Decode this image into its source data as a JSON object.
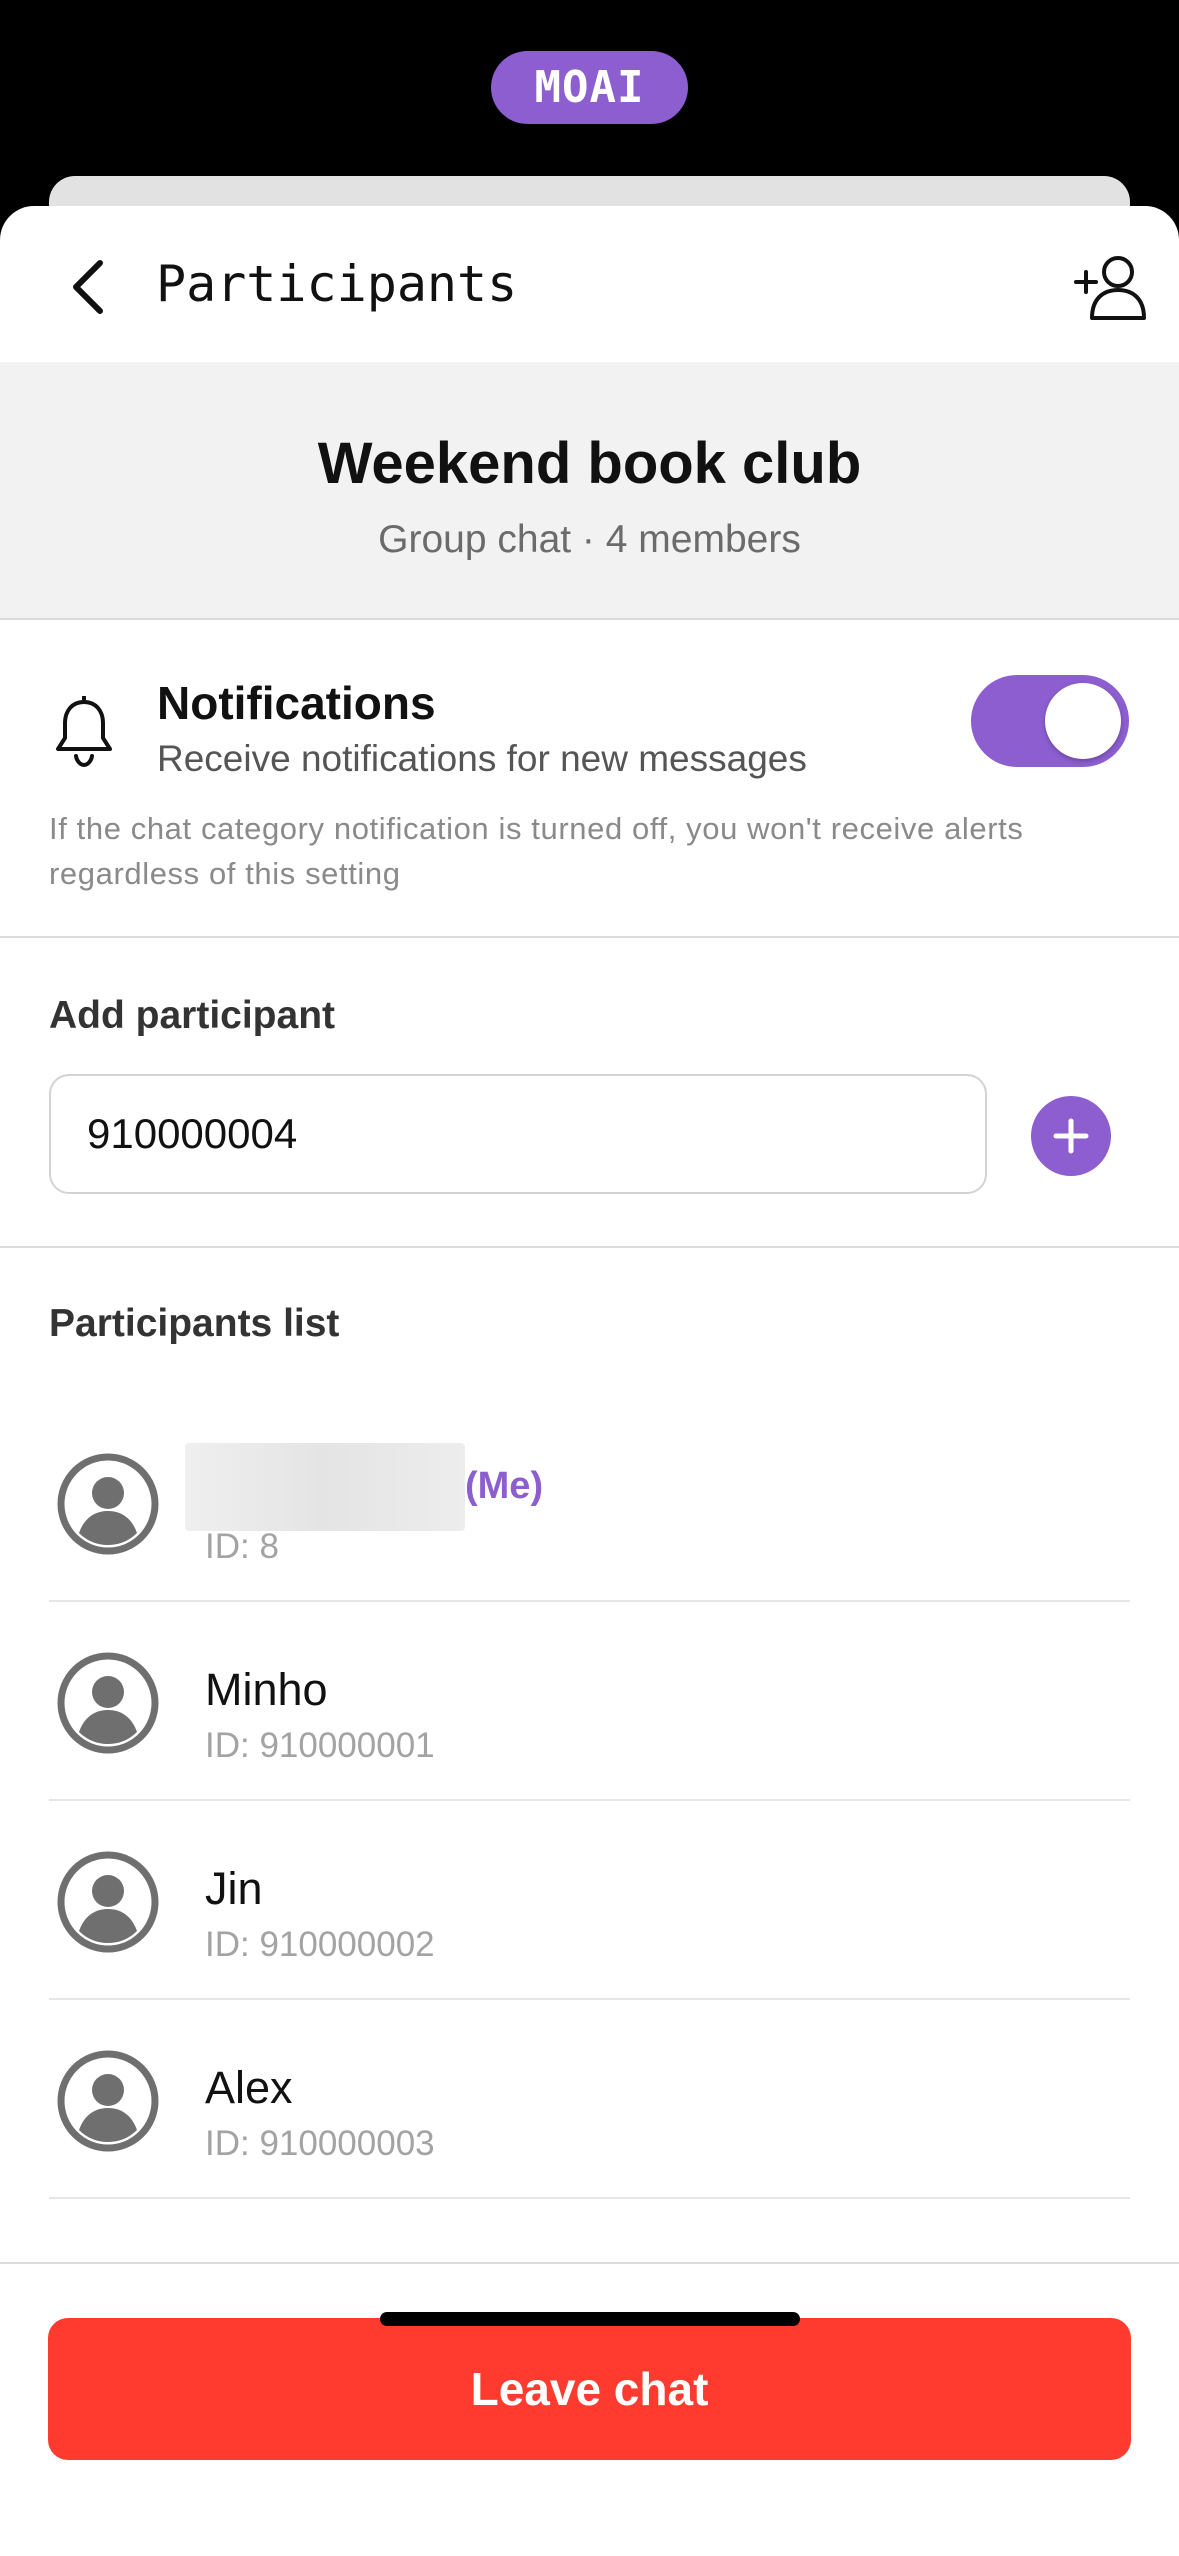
{
  "brand": {
    "logo_text": "MOAI"
  },
  "nav": {
    "title": "Participants"
  },
  "group": {
    "name": "Weekend book club",
    "meta": "Group chat · 4 members"
  },
  "notifications": {
    "title": "Notifications",
    "subtitle": "Receive notifications for new messages",
    "hint": "If the chat category notification is turned off, you won't receive alerts regardless of this setting",
    "enabled": true
  },
  "add_participant": {
    "title": "Add participant",
    "input_value": "910000004"
  },
  "participants": {
    "title": "Participants list",
    "items": [
      {
        "name": "",
        "tag": "(Me)",
        "id": "ID: 8"
      },
      {
        "name": "Minho",
        "tag": "",
        "id": "ID: 910000001"
      },
      {
        "name": "Jin",
        "tag": "",
        "id": "ID: 910000002"
      },
      {
        "name": "Alex",
        "tag": "",
        "id": "ID: 910000003"
      }
    ]
  },
  "footer": {
    "leave_label": "Leave chat"
  },
  "colors": {
    "accent": "#8c5ed0",
    "danger": "#ff3b30"
  },
  "icons": [
    "back-chevron-icon",
    "add-user-icon",
    "bell-icon",
    "plus-icon",
    "avatar-icon"
  ]
}
